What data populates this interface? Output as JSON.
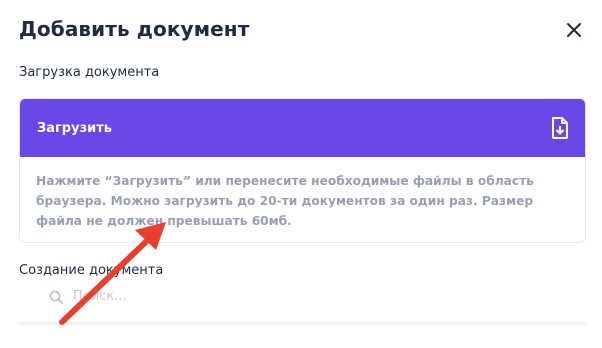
{
  "modal": {
    "title": "Добавить документ",
    "close_icon": "close-icon"
  },
  "upload": {
    "section_label": "Загрузка документа",
    "button_label": "Загрузить",
    "button_icon": "file-download-icon",
    "hint": "Нажмите “Загрузить” или перенесите необходимые файлы в область браузера. Можно загрузить до 20-ти документов за один раз. Размер файла не должен превышать 60мб.",
    "accent_color": "#6b46e8"
  },
  "create": {
    "section_label": "Создание документа",
    "search_placeholder": "Поиск...",
    "search_icon": "search-icon"
  },
  "annotation": {
    "arrow_color": "#e8402f",
    "arrow_icon": "red-arrow-icon"
  }
}
